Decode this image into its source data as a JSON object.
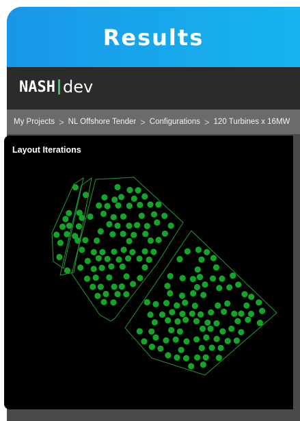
{
  "banner": {
    "title": "Results"
  },
  "app": {
    "brand": "NASH",
    "suffix": "dev"
  },
  "breadcrumb": {
    "items": [
      "My Projects",
      "NL Offshore Tender",
      "Configurations",
      "120 Turbines x 16MW"
    ],
    "separator": ">"
  },
  "panel": {
    "title": "Layout Iterations"
  },
  "colors": {
    "banner": "#17a3ea",
    "turbine": "#14a42a",
    "boundary": "#1f9a34",
    "panel_bg": "#000000",
    "logo_accent": "#3ec46d"
  }
}
